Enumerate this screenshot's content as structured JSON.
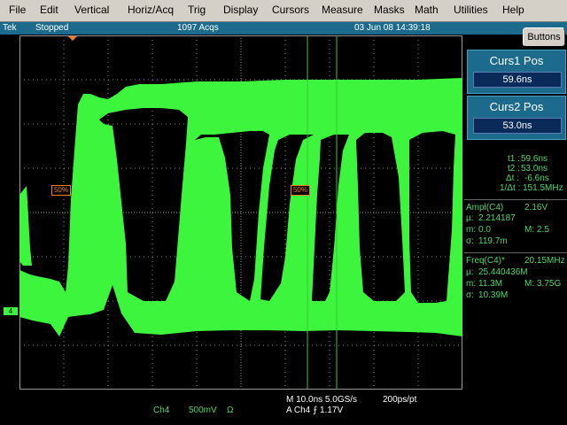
{
  "menu": {
    "items": [
      "File",
      "Edit",
      "Vertical",
      "Horiz/Acq",
      "Trig",
      "Display",
      "Cursors",
      "Measure",
      "Masks",
      "Math",
      "Utilities",
      "Help"
    ]
  },
  "status": {
    "brand": "Tek",
    "state": "Stopped",
    "acqs": "1097 Acqs",
    "datetime": "03 Jun 08 14:39:18",
    "buttons_label": "Buttons"
  },
  "cursors": {
    "c1_title": "Curs1 Pos",
    "c1_value": "59.6ns",
    "c2_title": "Curs2 Pos",
    "c2_value": "53.0ns",
    "t1_label": "t1 :",
    "t1_value": "59.6ns",
    "t2_label": "t2 :",
    "t2_value": "53.0ns",
    "dt_label": "Δt :",
    "dt_value": "-6.6ns",
    "inv_label": "1/Δt :",
    "inv_value": "151.5MHz"
  },
  "ampl": {
    "title": "Ampl(C4)",
    "value": "2.16V",
    "mu_label": "µ:",
    "mu": "2.214187",
    "m_label": "m:",
    "m": "0.0",
    "M_label": "M:",
    "M": "2.5",
    "sigma_label": "σ:",
    "sigma": "119.7m"
  },
  "freq": {
    "title": "Freq(C4)*",
    "value": "20.15MHz",
    "mu_label": "µ:",
    "mu": "25.440436M",
    "m_label": "m:",
    "m": "11.3M",
    "M_label": "M:",
    "M": "3.75G",
    "sigma_label": "σ:",
    "sigma": "10.39M"
  },
  "markers": {
    "ref_left": "50%",
    "ref_mid": "50%",
    "channel_marker": "4"
  },
  "bottom": {
    "horiz": "M 10.0ns 5.0GS/s",
    "resolution": "200ps/pt",
    "trigger": "A  Ch4  ⨍  1.17V",
    "channel": "Ch4",
    "scale": "500mV",
    "coupling": "Ω"
  },
  "colors": {
    "trace": "#3cf53c",
    "status_bar": "#1c6b8c",
    "measure_text": "#4fd86a",
    "cursor": "#36c836"
  }
}
